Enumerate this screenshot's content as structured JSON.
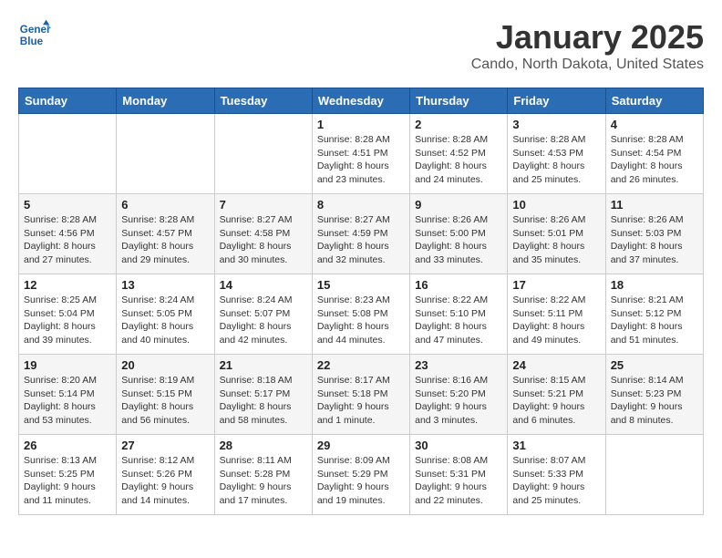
{
  "logo": {
    "line1": "General",
    "line2": "Blue"
  },
  "title": "January 2025",
  "subtitle": "Cando, North Dakota, United States",
  "weekdays": [
    "Sunday",
    "Monday",
    "Tuesday",
    "Wednesday",
    "Thursday",
    "Friday",
    "Saturday"
  ],
  "weeks": [
    [
      {
        "day": "",
        "sunrise": "",
        "sunset": "",
        "daylight": ""
      },
      {
        "day": "",
        "sunrise": "",
        "sunset": "",
        "daylight": ""
      },
      {
        "day": "",
        "sunrise": "",
        "sunset": "",
        "daylight": ""
      },
      {
        "day": "1",
        "sunrise": "Sunrise: 8:28 AM",
        "sunset": "Sunset: 4:51 PM",
        "daylight": "Daylight: 8 hours and 23 minutes."
      },
      {
        "day": "2",
        "sunrise": "Sunrise: 8:28 AM",
        "sunset": "Sunset: 4:52 PM",
        "daylight": "Daylight: 8 hours and 24 minutes."
      },
      {
        "day": "3",
        "sunrise": "Sunrise: 8:28 AM",
        "sunset": "Sunset: 4:53 PM",
        "daylight": "Daylight: 8 hours and 25 minutes."
      },
      {
        "day": "4",
        "sunrise": "Sunrise: 8:28 AM",
        "sunset": "Sunset: 4:54 PM",
        "daylight": "Daylight: 8 hours and 26 minutes."
      }
    ],
    [
      {
        "day": "5",
        "sunrise": "Sunrise: 8:28 AM",
        "sunset": "Sunset: 4:56 PM",
        "daylight": "Daylight: 8 hours and 27 minutes."
      },
      {
        "day": "6",
        "sunrise": "Sunrise: 8:28 AM",
        "sunset": "Sunset: 4:57 PM",
        "daylight": "Daylight: 8 hours and 29 minutes."
      },
      {
        "day": "7",
        "sunrise": "Sunrise: 8:27 AM",
        "sunset": "Sunset: 4:58 PM",
        "daylight": "Daylight: 8 hours and 30 minutes."
      },
      {
        "day": "8",
        "sunrise": "Sunrise: 8:27 AM",
        "sunset": "Sunset: 4:59 PM",
        "daylight": "Daylight: 8 hours and 32 minutes."
      },
      {
        "day": "9",
        "sunrise": "Sunrise: 8:26 AM",
        "sunset": "Sunset: 5:00 PM",
        "daylight": "Daylight: 8 hours and 33 minutes."
      },
      {
        "day": "10",
        "sunrise": "Sunrise: 8:26 AM",
        "sunset": "Sunset: 5:01 PM",
        "daylight": "Daylight: 8 hours and 35 minutes."
      },
      {
        "day": "11",
        "sunrise": "Sunrise: 8:26 AM",
        "sunset": "Sunset: 5:03 PM",
        "daylight": "Daylight: 8 hours and 37 minutes."
      }
    ],
    [
      {
        "day": "12",
        "sunrise": "Sunrise: 8:25 AM",
        "sunset": "Sunset: 5:04 PM",
        "daylight": "Daylight: 8 hours and 39 minutes."
      },
      {
        "day": "13",
        "sunrise": "Sunrise: 8:24 AM",
        "sunset": "Sunset: 5:05 PM",
        "daylight": "Daylight: 8 hours and 40 minutes."
      },
      {
        "day": "14",
        "sunrise": "Sunrise: 8:24 AM",
        "sunset": "Sunset: 5:07 PM",
        "daylight": "Daylight: 8 hours and 42 minutes."
      },
      {
        "day": "15",
        "sunrise": "Sunrise: 8:23 AM",
        "sunset": "Sunset: 5:08 PM",
        "daylight": "Daylight: 8 hours and 44 minutes."
      },
      {
        "day": "16",
        "sunrise": "Sunrise: 8:22 AM",
        "sunset": "Sunset: 5:10 PM",
        "daylight": "Daylight: 8 hours and 47 minutes."
      },
      {
        "day": "17",
        "sunrise": "Sunrise: 8:22 AM",
        "sunset": "Sunset: 5:11 PM",
        "daylight": "Daylight: 8 hours and 49 minutes."
      },
      {
        "day": "18",
        "sunrise": "Sunrise: 8:21 AM",
        "sunset": "Sunset: 5:12 PM",
        "daylight": "Daylight: 8 hours and 51 minutes."
      }
    ],
    [
      {
        "day": "19",
        "sunrise": "Sunrise: 8:20 AM",
        "sunset": "Sunset: 5:14 PM",
        "daylight": "Daylight: 8 hours and 53 minutes."
      },
      {
        "day": "20",
        "sunrise": "Sunrise: 8:19 AM",
        "sunset": "Sunset: 5:15 PM",
        "daylight": "Daylight: 8 hours and 56 minutes."
      },
      {
        "day": "21",
        "sunrise": "Sunrise: 8:18 AM",
        "sunset": "Sunset: 5:17 PM",
        "daylight": "Daylight: 8 hours and 58 minutes."
      },
      {
        "day": "22",
        "sunrise": "Sunrise: 8:17 AM",
        "sunset": "Sunset: 5:18 PM",
        "daylight": "Daylight: 9 hours and 1 minute."
      },
      {
        "day": "23",
        "sunrise": "Sunrise: 8:16 AM",
        "sunset": "Sunset: 5:20 PM",
        "daylight": "Daylight: 9 hours and 3 minutes."
      },
      {
        "day": "24",
        "sunrise": "Sunrise: 8:15 AM",
        "sunset": "Sunset: 5:21 PM",
        "daylight": "Daylight: 9 hours and 6 minutes."
      },
      {
        "day": "25",
        "sunrise": "Sunrise: 8:14 AM",
        "sunset": "Sunset: 5:23 PM",
        "daylight": "Daylight: 9 hours and 8 minutes."
      }
    ],
    [
      {
        "day": "26",
        "sunrise": "Sunrise: 8:13 AM",
        "sunset": "Sunset: 5:25 PM",
        "daylight": "Daylight: 9 hours and 11 minutes."
      },
      {
        "day": "27",
        "sunrise": "Sunrise: 8:12 AM",
        "sunset": "Sunset: 5:26 PM",
        "daylight": "Daylight: 9 hours and 14 minutes."
      },
      {
        "day": "28",
        "sunrise": "Sunrise: 8:11 AM",
        "sunset": "Sunset: 5:28 PM",
        "daylight": "Daylight: 9 hours and 17 minutes."
      },
      {
        "day": "29",
        "sunrise": "Sunrise: 8:09 AM",
        "sunset": "Sunset: 5:29 PM",
        "daylight": "Daylight: 9 hours and 19 minutes."
      },
      {
        "day": "30",
        "sunrise": "Sunrise: 8:08 AM",
        "sunset": "Sunset: 5:31 PM",
        "daylight": "Daylight: 9 hours and 22 minutes."
      },
      {
        "day": "31",
        "sunrise": "Sunrise: 8:07 AM",
        "sunset": "Sunset: 5:33 PM",
        "daylight": "Daylight: 9 hours and 25 minutes."
      },
      {
        "day": "",
        "sunrise": "",
        "sunset": "",
        "daylight": ""
      }
    ]
  ]
}
